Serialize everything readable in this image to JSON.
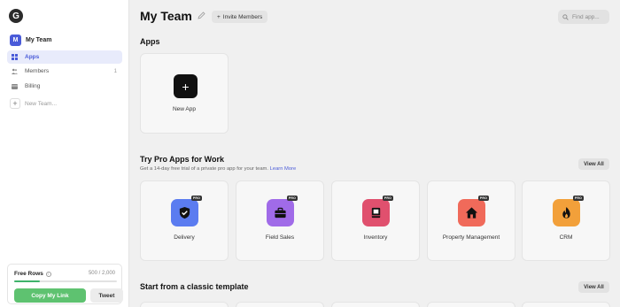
{
  "sidebar": {
    "logo": "G",
    "team": {
      "avatar": "M",
      "name": "My Team"
    },
    "items": [
      {
        "label": "Apps",
        "icon": "grid-icon",
        "active": true
      },
      {
        "label": "Members",
        "icon": "people-icon",
        "count": "1"
      },
      {
        "label": "Billing",
        "icon": "card-icon"
      }
    ],
    "new_team": "New Team...",
    "rows": {
      "label": "Free Rows",
      "count": "500 / 2,000",
      "progress": 0.25,
      "copy_label": "Copy My Link",
      "tweet_label": "Tweet"
    }
  },
  "header": {
    "title": "My Team",
    "invite_label": "Invite Members",
    "search_placeholder": "Find app..."
  },
  "apps_section": {
    "title": "Apps",
    "new_app_label": "New App"
  },
  "pro_section": {
    "title": "Try Pro Apps for Work",
    "subtitle": "Get a 14-day free trial of a private pro app for your team.",
    "learn_more": "Learn More",
    "view_all": "View All",
    "badge": "PRO",
    "apps": [
      {
        "label": "Delivery",
        "icon": "shield-check-icon",
        "color": "#5b7cf0"
      },
      {
        "label": "Field Sales",
        "icon": "briefcase-icon",
        "color": "#a06be8"
      },
      {
        "label": "Inventory",
        "icon": "book-icon",
        "color": "#e0506e"
      },
      {
        "label": "Property Management",
        "icon": "house-icon",
        "color": "#f06a5a"
      },
      {
        "label": "CRM",
        "icon": "flame-icon",
        "color": "#f2a03a"
      }
    ]
  },
  "template_section": {
    "title": "Start from a classic template",
    "view_all": "View All"
  }
}
